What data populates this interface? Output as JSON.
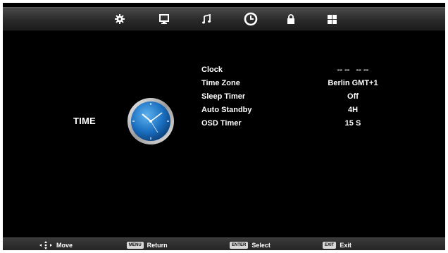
{
  "tabs": [
    {
      "icon": "gear-icon",
      "selected": false
    },
    {
      "icon": "monitor-icon",
      "selected": false
    },
    {
      "icon": "music-note-icon",
      "selected": false
    },
    {
      "icon": "clock-icon",
      "selected": true
    },
    {
      "icon": "lock-icon",
      "selected": false
    },
    {
      "icon": "grid-icon",
      "selected": false
    }
  ],
  "page": {
    "title": "TIME",
    "icon": "analog-clock-icon"
  },
  "settings": [
    {
      "label": "Clock",
      "value": "-- --   -- --"
    },
    {
      "label": "Time Zone",
      "value": "Berlin GMT+1"
    },
    {
      "label": "Sleep Timer",
      "value": "Off"
    },
    {
      "label": "Auto Standby",
      "value": "4H"
    },
    {
      "label": "OSD Timer",
      "value": "15 S"
    }
  ],
  "help": {
    "move": {
      "label": "Move"
    },
    "menu": {
      "key": "MENU",
      "label": "Return"
    },
    "enter": {
      "key": "ENTER",
      "label": "Select"
    },
    "exit": {
      "key": "EXIT",
      "label": "Exit"
    }
  },
  "colors": {
    "background": "#000000",
    "bar": "#2a2a2a",
    "clock_face": "#1a6fc0",
    "clock_rim": "#c8c8c8"
  }
}
